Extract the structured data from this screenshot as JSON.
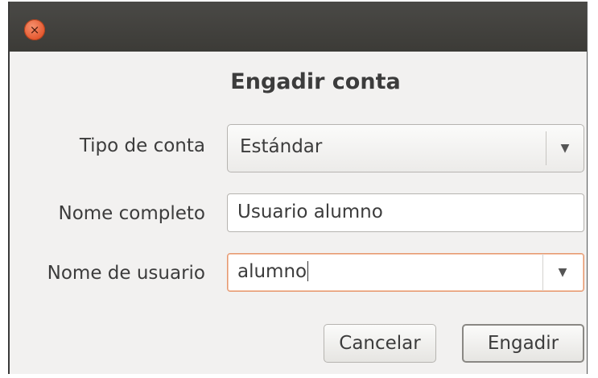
{
  "window": {
    "close_icon": "close-icon",
    "close_glyph": "×"
  },
  "dialog": {
    "title": "Engadir conta"
  },
  "form": {
    "account_type": {
      "label": "Tipo de conta",
      "value": "Estándar"
    },
    "full_name": {
      "label": "Nome completo",
      "value": "Usuario alumno"
    },
    "username": {
      "label": "Nome de usuario",
      "value": "alumno"
    }
  },
  "buttons": {
    "cancel": "Cancelar",
    "add": "Engadir"
  },
  "colors": {
    "titlebar": "#3c3b37",
    "close_button": "#e4582f",
    "focus_border": "#e6986f",
    "dialog_bg": "#f2f1f0"
  }
}
